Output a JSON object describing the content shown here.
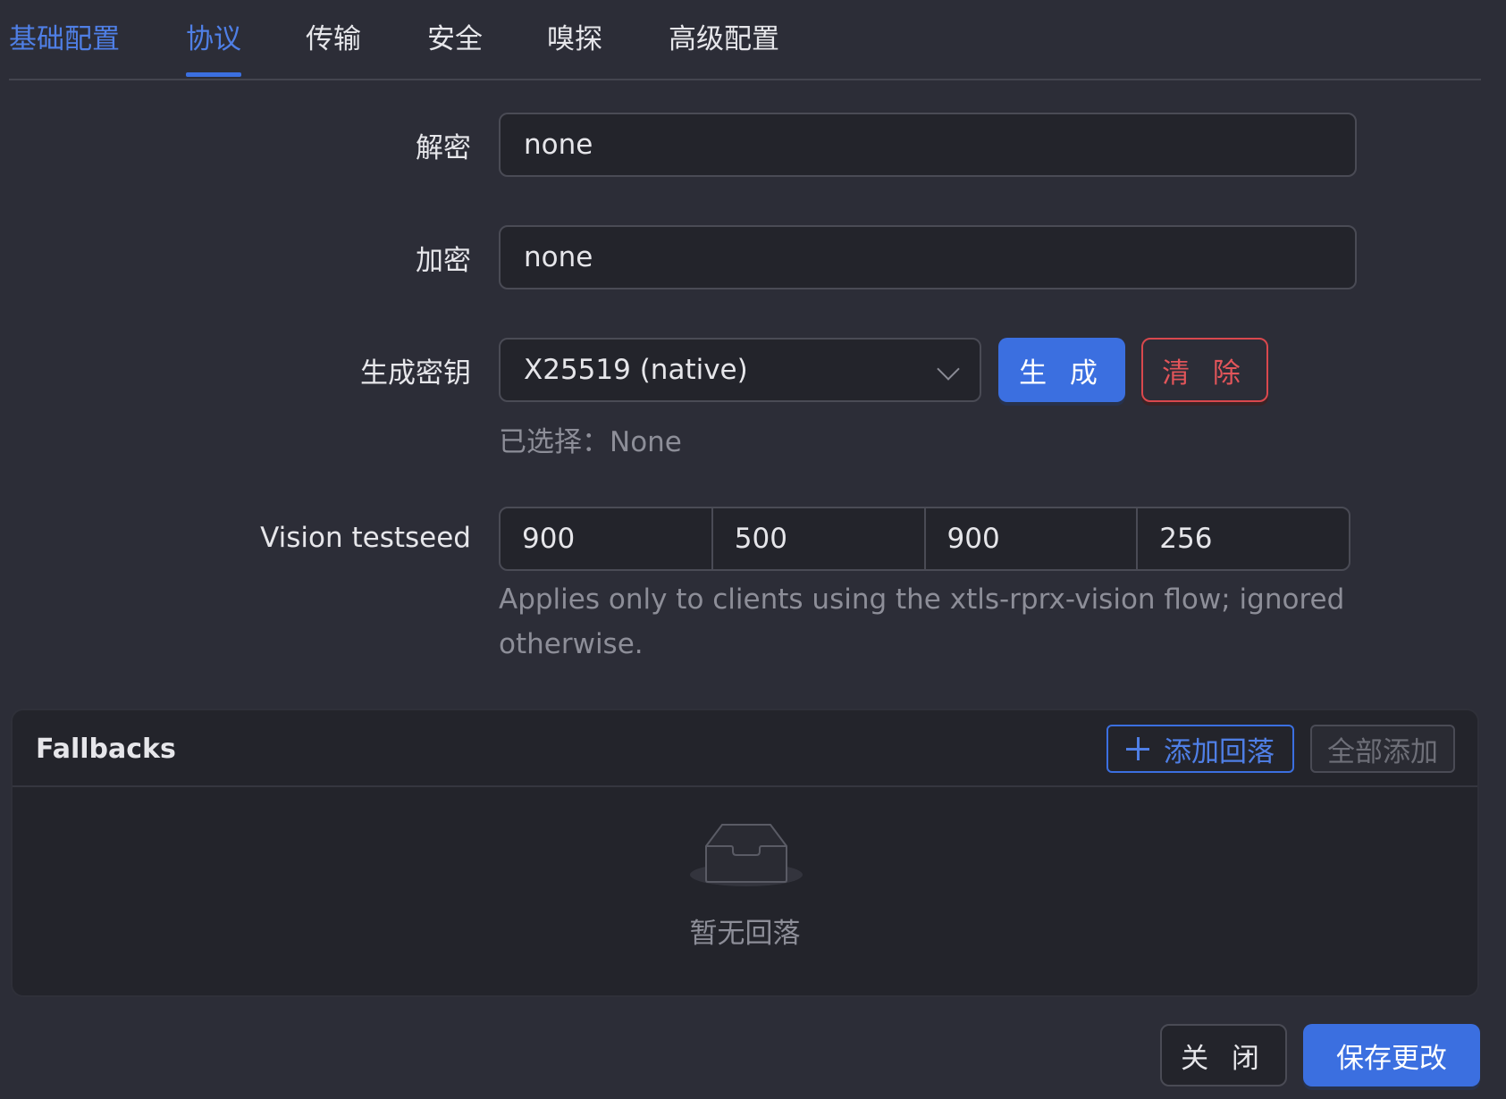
{
  "tabs": [
    {
      "label": "基础配置"
    },
    {
      "label": "协议"
    },
    {
      "label": "传输"
    },
    {
      "label": "安全"
    },
    {
      "label": "嗅探"
    },
    {
      "label": "高级配置"
    }
  ],
  "form": {
    "decryption": {
      "label": "解密",
      "value": "none"
    },
    "encryption": {
      "label": "加密",
      "value": "none"
    },
    "keygen": {
      "label": "生成密钥",
      "selected": "X25519 (native)",
      "generate_label": "生 成",
      "clear_label": "清 除",
      "hint": "已选择：None"
    },
    "vision": {
      "label": "Vision testseed",
      "values": [
        "900",
        "500",
        "900",
        "256"
      ],
      "help": "Applies only to clients using the xtls-rprx-vision flow; ignored",
      "help2": "otherwise."
    }
  },
  "fallbacks": {
    "title": "Fallbacks",
    "add_label": "添加回落",
    "add_all_label": "全部添加",
    "empty_text": "暂无回落"
  },
  "footer": {
    "close_label": "关 闭",
    "save_label": "保存更改"
  },
  "colors": {
    "accent": "#3b6fe0",
    "danger": "#d9484d",
    "background": "#2c2d37"
  }
}
